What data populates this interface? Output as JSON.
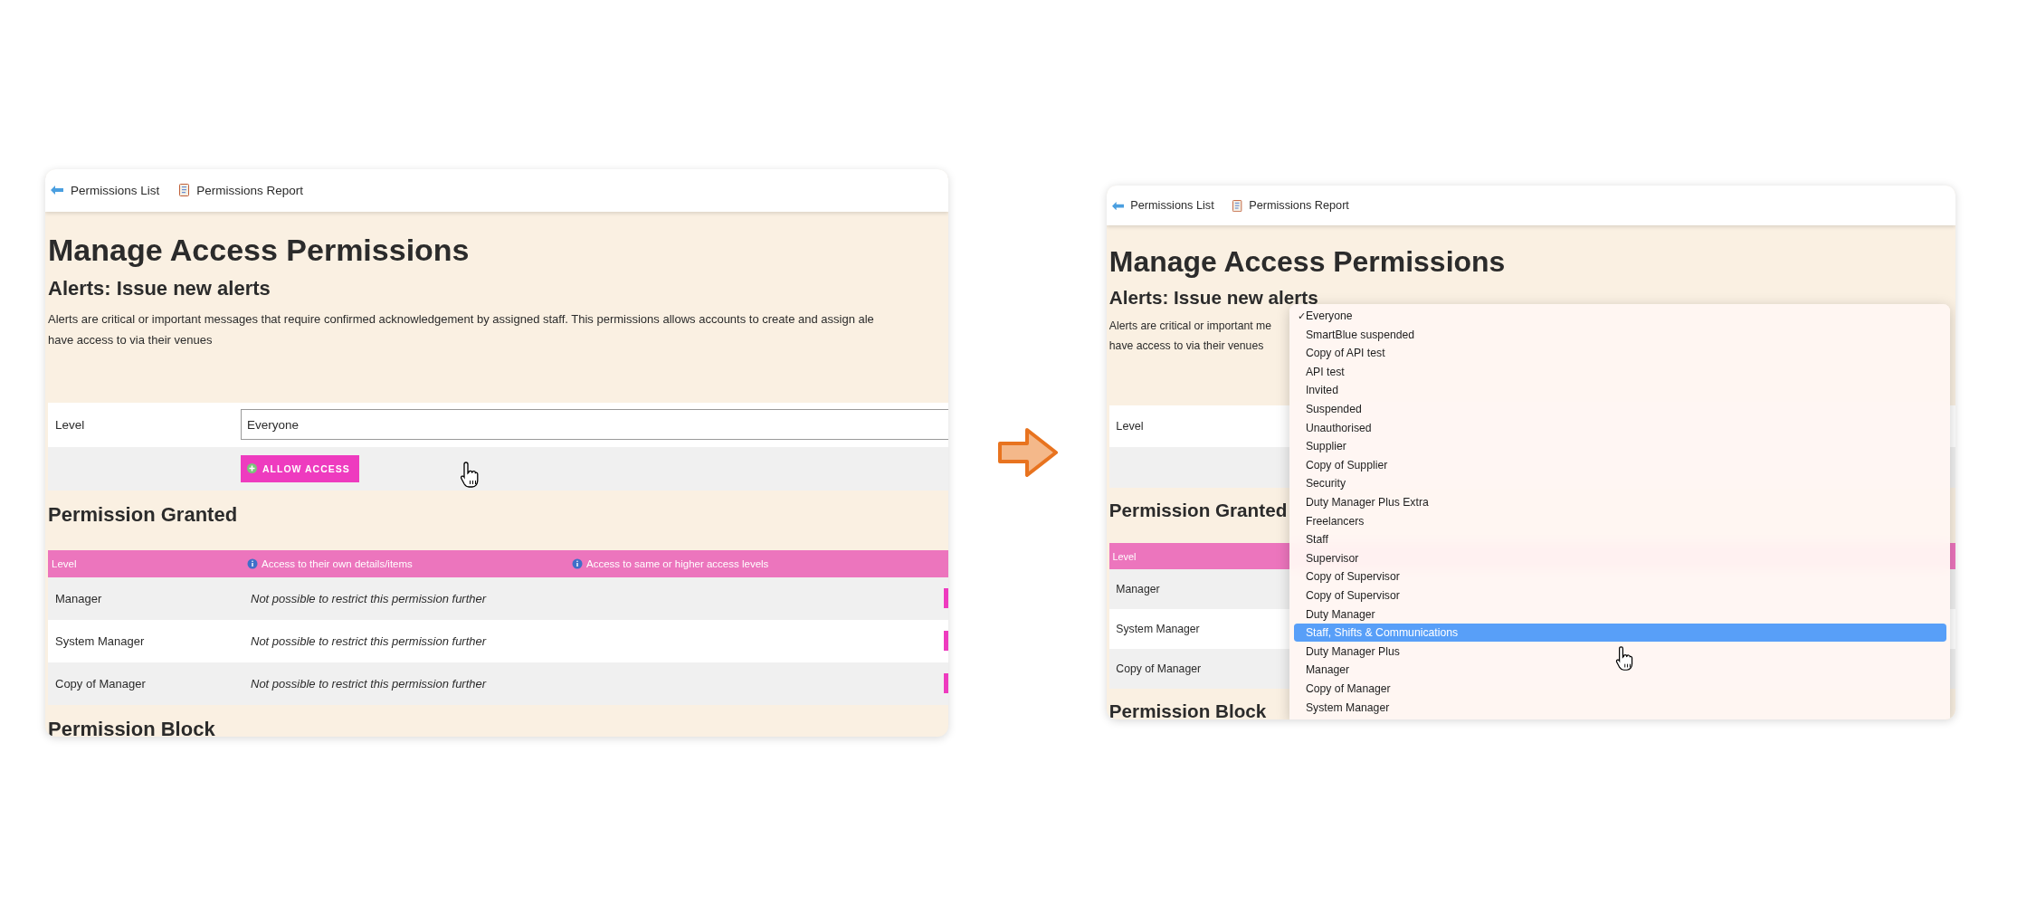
{
  "panels": [
    {
      "toolbar": [
        {
          "label": "Permissions List",
          "kind": "back"
        },
        {
          "label": "Permissions Report",
          "kind": "report"
        }
      ],
      "title": "Manage Access Permissions",
      "subtitle": "Alerts: Issue new alerts",
      "description_lines": [
        "Alerts are critical or important messages that require confirmed acknowledgement by assigned staff. This permissions allows accounts to create and assign ale",
        "have access to via their venues"
      ],
      "level_field": {
        "label": "Level",
        "value": "Everyone"
      },
      "allow_button": "ALLOW ACCESS",
      "granted_heading": "Permission Granted",
      "table": {
        "columns": [
          "Level",
          "Access to their own details/items",
          "Access to same or higher access levels"
        ],
        "rows": [
          {
            "level": "Manager",
            "access_own": "Not possible to restrict this permission further"
          },
          {
            "level": "System Manager",
            "access_own": "Not possible to restrict this permission further"
          },
          {
            "level": "Copy of Manager",
            "access_own": "Not possible to restrict this permission further"
          }
        ]
      },
      "block_heading": "Permission Block"
    },
    {
      "toolbar": [
        {
          "label": "Permissions List",
          "kind": "back"
        },
        {
          "label": "Permissions Report",
          "kind": "report"
        }
      ],
      "title": "Manage Access Permissions",
      "subtitle": "Alerts: Issue new alerts",
      "description_lines": [
        "Alerts are critical or important me",
        "have access to via their venues"
      ],
      "level_field": {
        "label": "Level"
      },
      "granted_heading": "Permission Granted",
      "table": {
        "columns": [
          "Level"
        ],
        "rows": [
          {
            "level": "Manager"
          },
          {
            "level": "System Manager"
          },
          {
            "level": "Copy of Manager"
          }
        ]
      },
      "block_heading": "Permission Block",
      "dropdown": {
        "options": [
          {
            "label": "Everyone",
            "check_mark": "✓",
            "selected": false
          },
          {
            "label": "SmartBlue suspended",
            "selected": false
          },
          {
            "label": "Copy of API test",
            "selected": false
          },
          {
            "label": "API test",
            "selected": false
          },
          {
            "label": "Invited",
            "selected": false
          },
          {
            "label": "Suspended",
            "selected": false
          },
          {
            "label": "Unauthorised",
            "selected": false
          },
          {
            "label": "Supplier",
            "selected": false
          },
          {
            "label": "Copy of Supplier",
            "selected": false
          },
          {
            "label": "Security",
            "selected": false
          },
          {
            "label": "Duty Manager Plus Extra",
            "selected": false
          },
          {
            "label": "Freelancers",
            "selected": false
          },
          {
            "label": "Staff",
            "selected": false
          },
          {
            "label": "Supervisor",
            "selected": false
          },
          {
            "label": "Copy of Supervisor",
            "selected": false
          },
          {
            "label": "Copy of Supervisor",
            "selected": false
          },
          {
            "label": "Duty Manager",
            "selected": false
          },
          {
            "label": "Staff, Shifts & Communications",
            "selected": true
          },
          {
            "label": "Duty Manager Plus",
            "selected": false
          },
          {
            "label": "Manager",
            "selected": false
          },
          {
            "label": "Copy of Manager",
            "selected": false
          },
          {
            "label": "System Manager",
            "selected": false
          }
        ]
      }
    }
  ]
}
